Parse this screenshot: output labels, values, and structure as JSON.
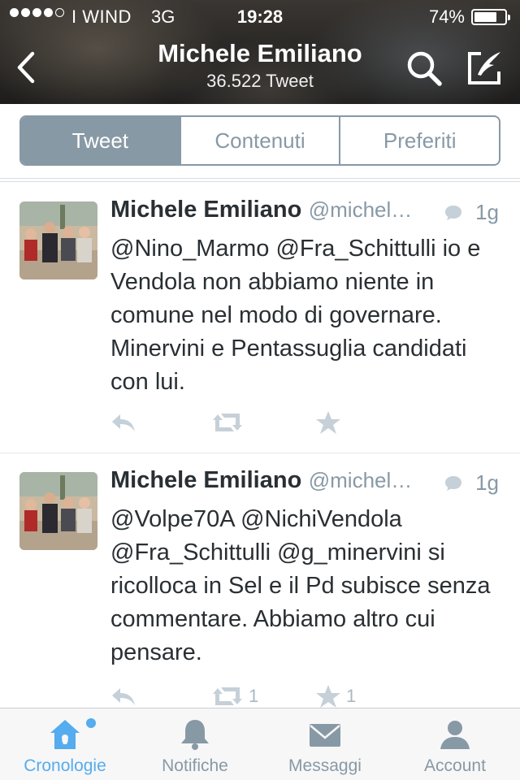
{
  "status_bar": {
    "carrier": "I WIND",
    "network": "3G",
    "time": "19:28",
    "battery_percent": "74%",
    "battery_level": 0.74,
    "signal_bars_filled": 4,
    "signal_bars_total": 5
  },
  "header": {
    "name": "Michele Emiliano",
    "tweet_count": "36.522 Tweet",
    "back_icon": "chevron-left-icon",
    "search_icon": "search-icon",
    "compose_icon": "compose-icon"
  },
  "segments": [
    {
      "label": "Tweet",
      "active": true
    },
    {
      "label": "Contenuti",
      "active": false
    },
    {
      "label": "Preferiti",
      "active": false
    }
  ],
  "tweets": [
    {
      "author": "Michele Emiliano",
      "handle": "@michel…",
      "time": "1g",
      "text": "@Nino_Marmo @Fra_Schittulli io e Vendola non abbiamo niente in comune nel modo di governare. Minervini e Pentassuglia candidati con lui.",
      "retweets": "",
      "favorites": ""
    },
    {
      "author": "Michele Emiliano",
      "handle": "@michel…",
      "time": "1g",
      "text": "@Volpe70A @NichiVendola @Fra_Schittulli @g_minervini si ricolloca in Sel e il Pd subisce senza commentare. Abbiamo altro cui pensare.",
      "retweets": "1",
      "favorites": "1"
    }
  ],
  "tabbar": [
    {
      "label": "Cronologie",
      "icon": "home-icon",
      "active": true
    },
    {
      "label": "Notifiche",
      "icon": "bell-icon",
      "active": false
    },
    {
      "label": "Messaggi",
      "icon": "envelope-icon",
      "active": false
    },
    {
      "label": "Account",
      "icon": "person-icon",
      "active": false
    }
  ],
  "colors": {
    "accent": "#55acee",
    "segment": "#8899a6",
    "text": "#292f33",
    "muted": "#8899a6",
    "action": "#aab8c2"
  }
}
